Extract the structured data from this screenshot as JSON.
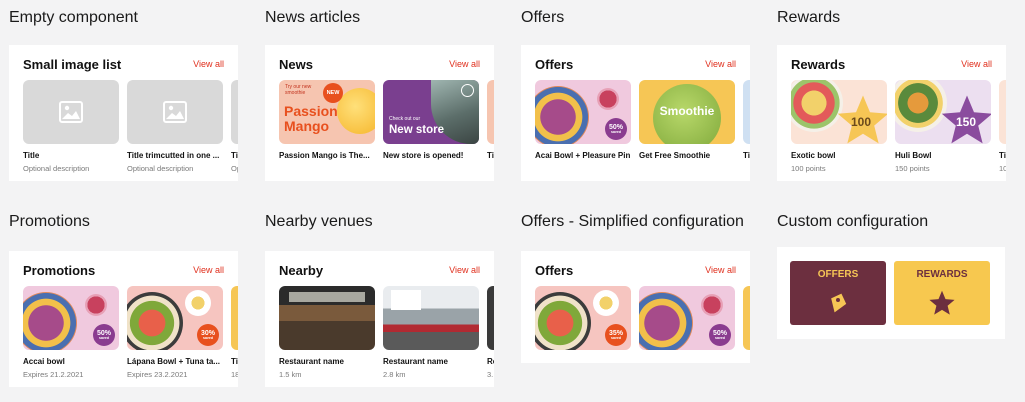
{
  "sections": {
    "empty": "Empty component",
    "news": "News articles",
    "offers": "Offers",
    "rewards": "Rewards",
    "promotions": "Promotions",
    "nearby": "Nearby venues",
    "offers_simple": "Offers - Simplified configuration",
    "custom": "Custom configuration"
  },
  "view_all": "View all",
  "empty_card": {
    "heading": "Small image list",
    "items": [
      {
        "title": "Title",
        "sub": "Optional description"
      },
      {
        "title": "Title trimcutted in one ...",
        "sub": "Optional description"
      },
      {
        "title": "Ti",
        "sub": "Op"
      }
    ]
  },
  "news_card": {
    "heading": "News",
    "items": [
      {
        "title": "Passion Mango is The...",
        "promo_small": "Try our new smoothie",
        "promo_big": "Passion Mango",
        "badge": "NEW"
      },
      {
        "title": "New store is opened!",
        "promo_small": "Check out our",
        "promo_big": "New store"
      },
      {
        "title": "Ti"
      }
    ]
  },
  "offers_card": {
    "heading": "Offers",
    "items": [
      {
        "title": "Acai Bowl + Pleasure Pin",
        "badge": "50%"
      },
      {
        "title": "Get Free Smoothie",
        "promo": "Smoothie"
      },
      {
        "title": "Ti"
      }
    ]
  },
  "rewards_card": {
    "heading": "Rewards",
    "items": [
      {
        "title": "Exotic bowl",
        "sub": "100 points",
        "star": "100"
      },
      {
        "title": "Huli Bowl",
        "sub": "150 points",
        "star": "150"
      },
      {
        "title": "Ti",
        "sub": "10"
      }
    ]
  },
  "promotions_card": {
    "heading": "Promotions",
    "items": [
      {
        "title": "Accai bowl",
        "sub": "Expires 21.2.2021",
        "badge": "50%"
      },
      {
        "title": "Lápana Bowl + Tuna ta...",
        "sub": "Expires 23.2.2021",
        "badge": "30%"
      },
      {
        "title": "Ti",
        "sub": "18"
      }
    ]
  },
  "nearby_card": {
    "heading": "Nearby",
    "items": [
      {
        "title": "Restaurant name",
        "sub": "1.5 km"
      },
      {
        "title": "Restaurant name",
        "sub": "2.8 km"
      },
      {
        "title": "Re",
        "sub": "3."
      }
    ]
  },
  "offers_simple_card": {
    "heading": "Offers",
    "items": [
      {
        "badge": "35%"
      },
      {
        "badge": "50%"
      },
      {}
    ]
  },
  "custom_card": {
    "tiles": [
      {
        "label": "OFFERS",
        "icon": "tag-icon"
      },
      {
        "label": "REWARDS",
        "icon": "star-icon"
      }
    ]
  },
  "badge_small_text": "saved",
  "colors": {
    "accent": "#e0301e",
    "placeholder": "#d9d9d9",
    "purple": "#7a4a9e",
    "offers_tile": "#6c2f3f",
    "rewards_tile": "#f7c84f"
  }
}
